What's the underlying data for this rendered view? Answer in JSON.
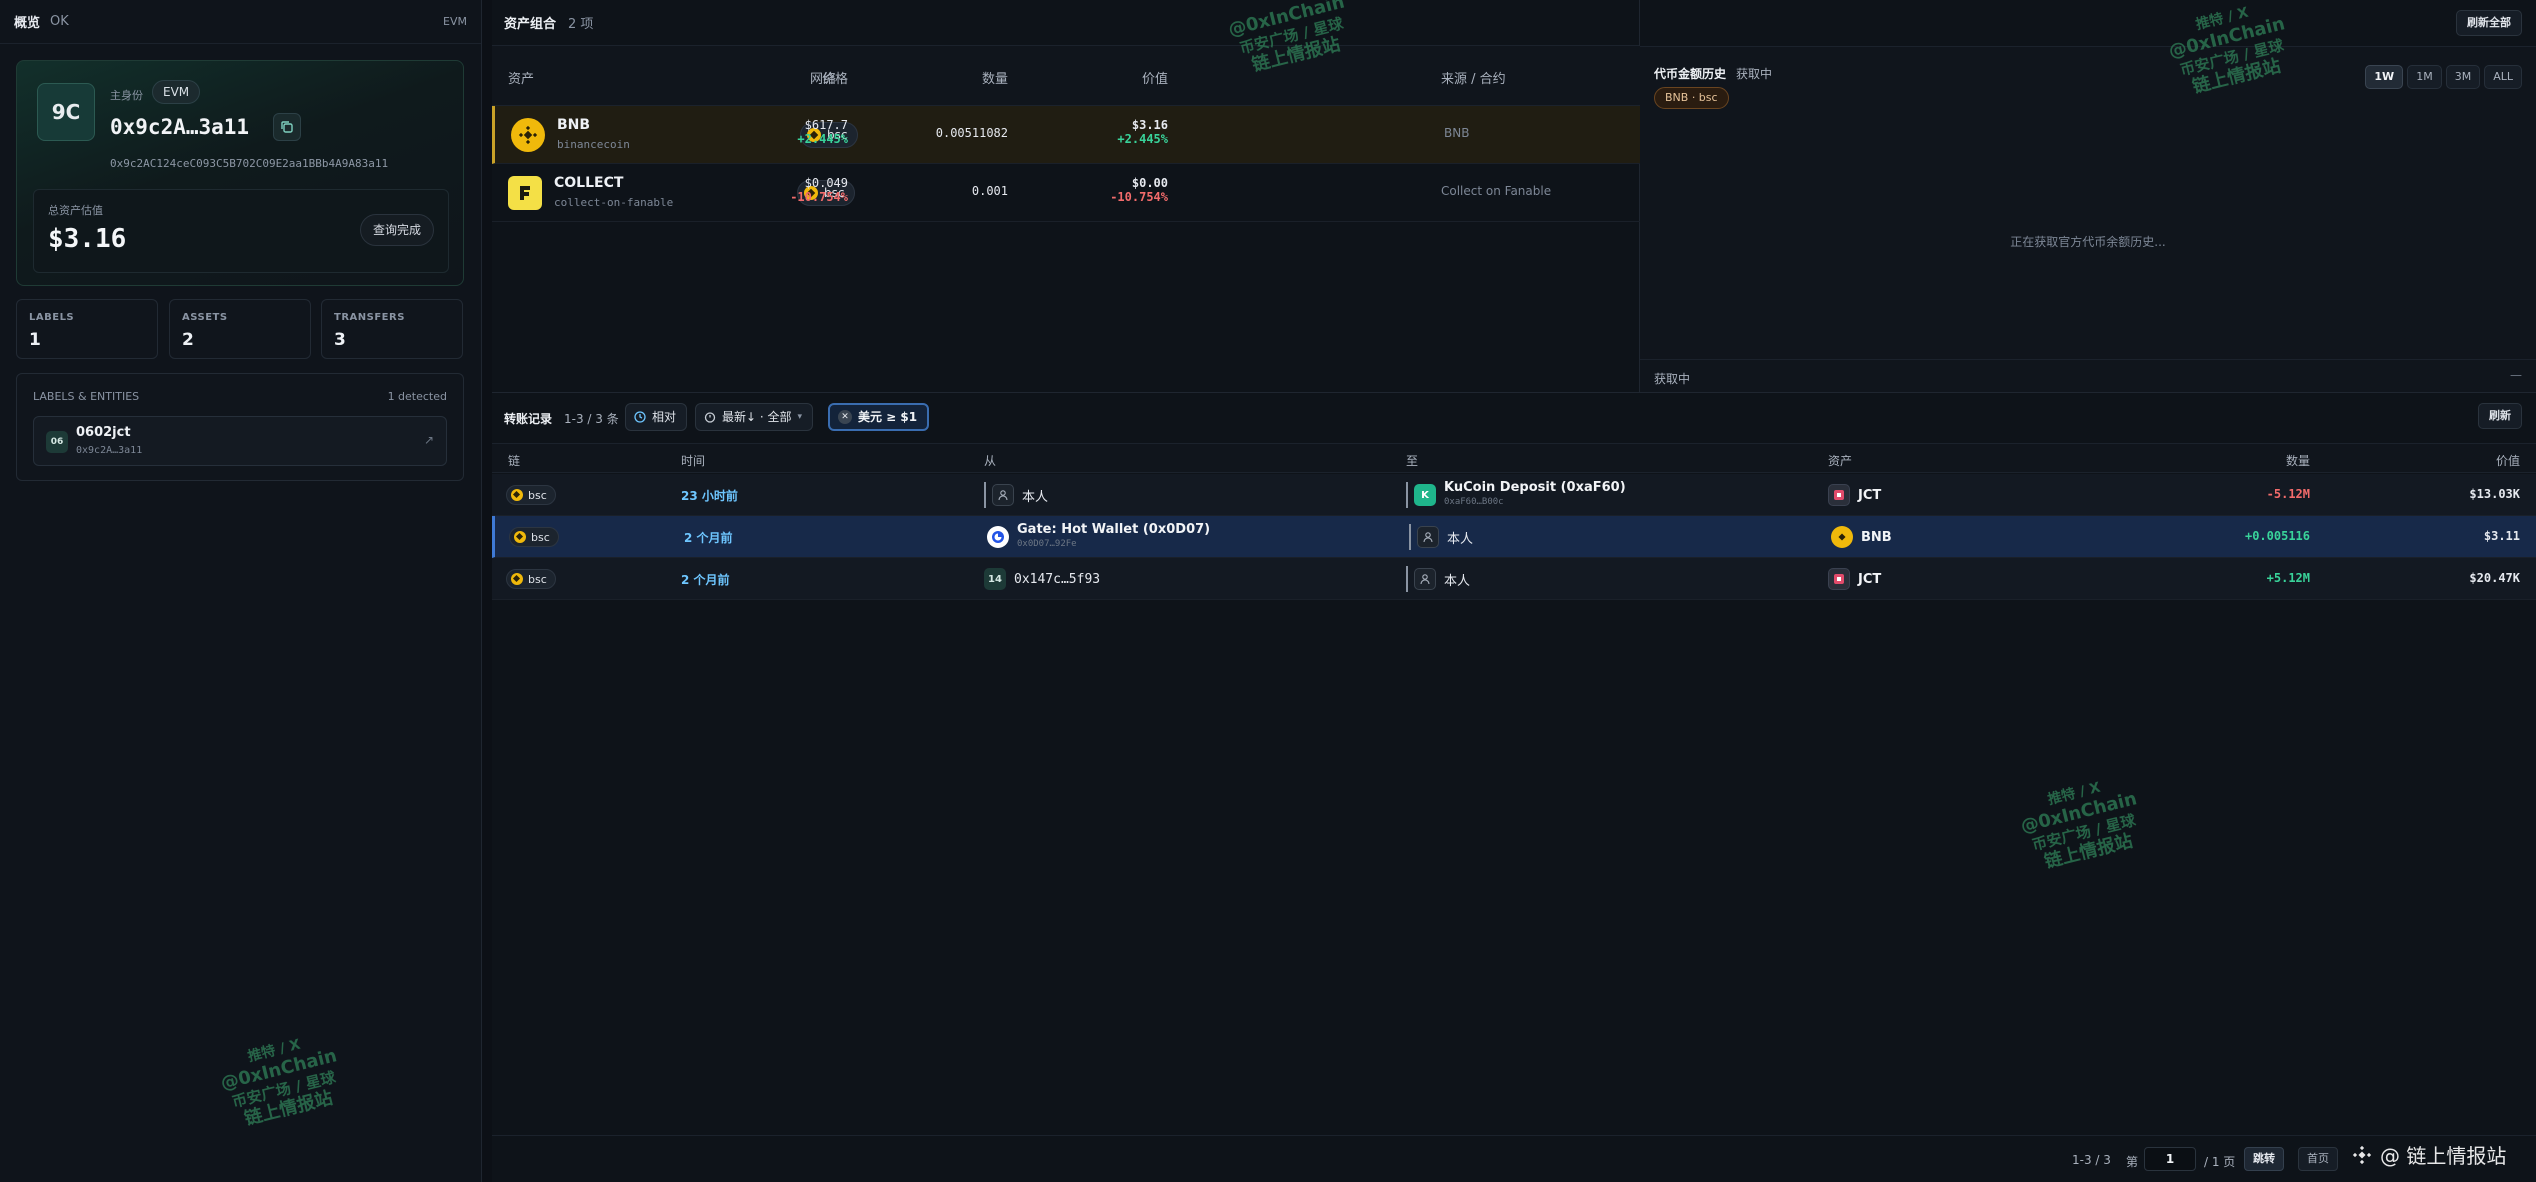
{
  "left": {
    "header": {
      "title": "概览",
      "status": "OK",
      "chain": "EVM"
    },
    "identity": {
      "avatar": "9C",
      "main_label": "主身份",
      "badge": "EVM",
      "short_address": "0x9c2A…3a11",
      "full_address": "0x9c2AC124ceC093C5B702C09E2aa1BBb4A9A83a11",
      "balance_label": "总资产估值",
      "balance_value": "$3.16",
      "query_button": "查询完成"
    },
    "stats": [
      {
        "key": "LABELS",
        "value": "1"
      },
      {
        "key": "ASSETS",
        "value": "2"
      },
      {
        "key": "TRANSFERS",
        "value": "3"
      }
    ],
    "entities": {
      "title": "LABELS & ENTITIES",
      "detected": "1 detected",
      "item": {
        "badge": "06",
        "name": "0602jct",
        "address": "0x9c2A…3a11",
        "arrow": "↗"
      }
    }
  },
  "portfolio": {
    "title": "资产组合",
    "count": "2 项",
    "columns": [
      "资产",
      "网络",
      "价格",
      "数量",
      "价值",
      "来源 / 合约"
    ],
    "rows": [
      {
        "name": "BNB",
        "sub": "binancecoin",
        "network": "bsc",
        "price": "$617.7",
        "price_change": "+2.445%",
        "qty": "0.00511082",
        "value": "$3.16",
        "value_change": "+2.445%",
        "source": "BNB"
      },
      {
        "name": "COLLECT",
        "sub": "collect-on-fanable",
        "network": "bsc",
        "price": "$0.049",
        "price_change": "-10.754%",
        "qty": "0.001",
        "value": "$0.00",
        "value_change": "-10.754%",
        "source": "Collect on Fanable"
      }
    ]
  },
  "history": {
    "refresh_all": "刷新全部",
    "title": "代币金额历史",
    "status": "获取中",
    "tag": "BNB · bsc",
    "ranges": [
      "1W",
      "1M",
      "3M",
      "ALL"
    ],
    "active_range": "1W",
    "loading": "正在获取官方代币余额历史...",
    "footer_left": "获取中",
    "footer_right": "—"
  },
  "transfers": {
    "title": "转账记录",
    "count": "1-3 / 3 条",
    "chips": {
      "relative": "相对",
      "sort": "最新↓ · 全部",
      "min_usd": "美元 ≥ $1"
    },
    "refresh": "刷新",
    "columns": [
      "链",
      "时间",
      "从",
      "至",
      "资产",
      "数量",
      "价值"
    ],
    "rows": [
      {
        "chain": "bsc",
        "time": "23 小时前",
        "from": "本人",
        "to": "KuCoin Deposit (0xaF60)",
        "to_sub": "0xaF60…B00c",
        "asset": "JCT",
        "amount": "-5.12M",
        "value": "$13.03K"
      },
      {
        "chain": "bsc",
        "time": "2 个月前",
        "from": "Gate: Hot Wallet (0x0D07)",
        "from_sub": "0x0D07…92Fe",
        "to": "本人",
        "asset": "BNB",
        "amount": "+0.005116",
        "value": "$3.11"
      },
      {
        "chain": "bsc",
        "time": "2 个月前",
        "from_badge": "14",
        "from": "0x147c…5f93",
        "to": "本人",
        "asset": "JCT",
        "amount": "+5.12M",
        "value": "$20.47K"
      }
    ],
    "pager": {
      "count": "1-3 / 3",
      "page_prefix": "第",
      "page_value": "1",
      "page_suffix": "/ 1 页",
      "goto": "跳转",
      "first": "首页"
    }
  },
  "watermark": {
    "line1": "推特 / X",
    "line2": "@0xInChain",
    "line3": "币安广场 / 星球",
    "line4": "链上情报站",
    "corner": "@ 链上情报站"
  },
  "colors": {
    "up": "#39d39a",
    "down": "#f26b6b",
    "accent": "#3f7ad6",
    "bnb": "#f0b90b"
  }
}
